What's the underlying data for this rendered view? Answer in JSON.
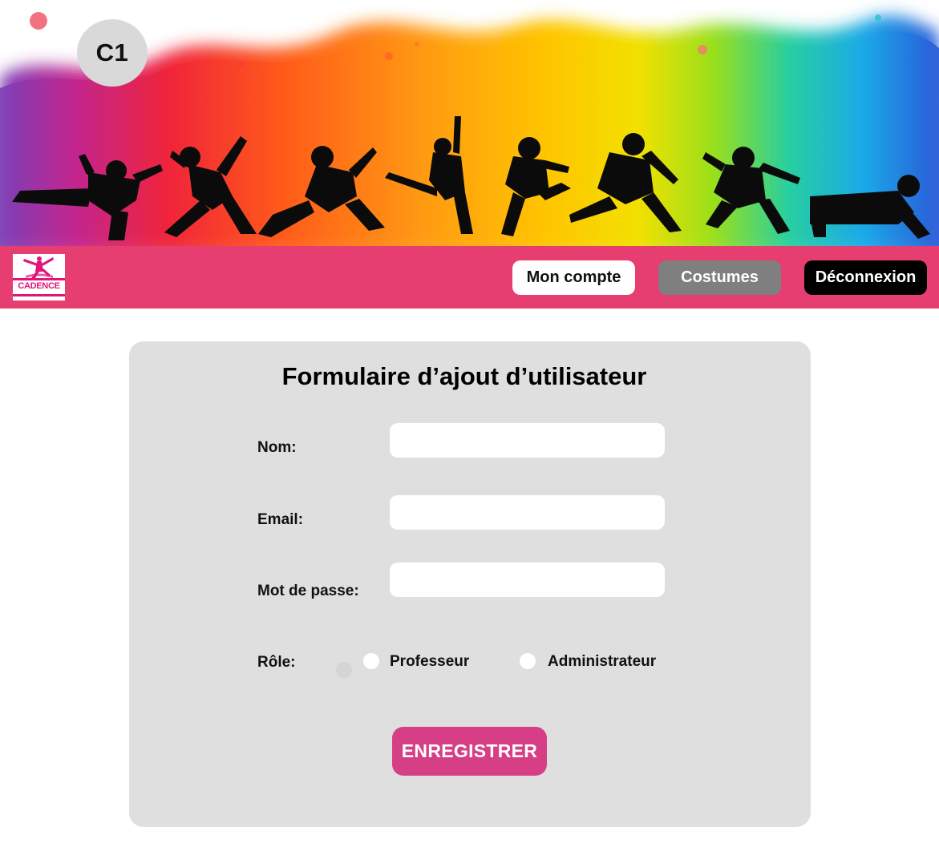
{
  "hero": {
    "badge": "C1",
    "image_description_icon": "dancers-silhouette-banner"
  },
  "nav": {
    "logo_text": "CADENCE",
    "account_label": "Mon compte",
    "costumes_label": "Costumes",
    "logout_label": "Déconnexion",
    "colors": {
      "bar": "#e63e70",
      "account": "#ffffff",
      "costumes": "#7f7f7f",
      "logout": "#000000"
    }
  },
  "form": {
    "title": "Formulaire d’ajout d’utilisateur",
    "name_label": "Nom:",
    "name_value": "",
    "email_label": "Email:",
    "email_value": "",
    "password_label": "Mot de passe:",
    "password_value": "",
    "role_label": "Rôle:",
    "role_options": [
      "Professeur",
      "Administrateur"
    ],
    "submit_label": "ENREGISTRER",
    "colors": {
      "card": "#e0dfe0",
      "submit": "#d63f85"
    }
  }
}
